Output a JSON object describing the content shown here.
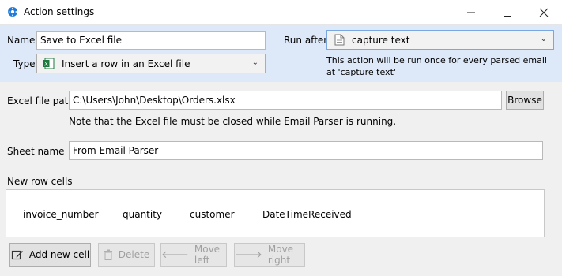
{
  "window": {
    "title": "Action settings",
    "minimize_icon": "minimize-icon",
    "maximize_icon": "maximize-icon",
    "close_icon": "close-icon"
  },
  "top": {
    "name_label": "Name",
    "name_value": "Save to Excel file",
    "type_label": "Type",
    "type_value": "Insert a row in an Excel file",
    "run_after_label": "Run after",
    "run_after_value": "capture text",
    "run_after_note": "This action will be run once for every parsed email at 'capture text'"
  },
  "excel": {
    "path_label": "Excel file path",
    "path_value": "C:\\Users\\John\\Desktop\\Orders.xlsx",
    "browse_label": "Browse",
    "note": "Note that the Excel file must be closed while Email Parser is running."
  },
  "sheet": {
    "label": "Sheet name",
    "value": "From Email Parser"
  },
  "cells": {
    "label": "New row cells",
    "items": [
      "invoice_number",
      "quantity",
      "customer",
      "DateTimeReceived"
    ]
  },
  "actions": {
    "add_label": "Add new cell",
    "delete_label": "Delete",
    "move_left_label": "Move left",
    "move_right_label": "Move right"
  },
  "colors": {
    "top_panel_bg": "#dde8f8",
    "accent_blue": "#1e7ad8"
  }
}
